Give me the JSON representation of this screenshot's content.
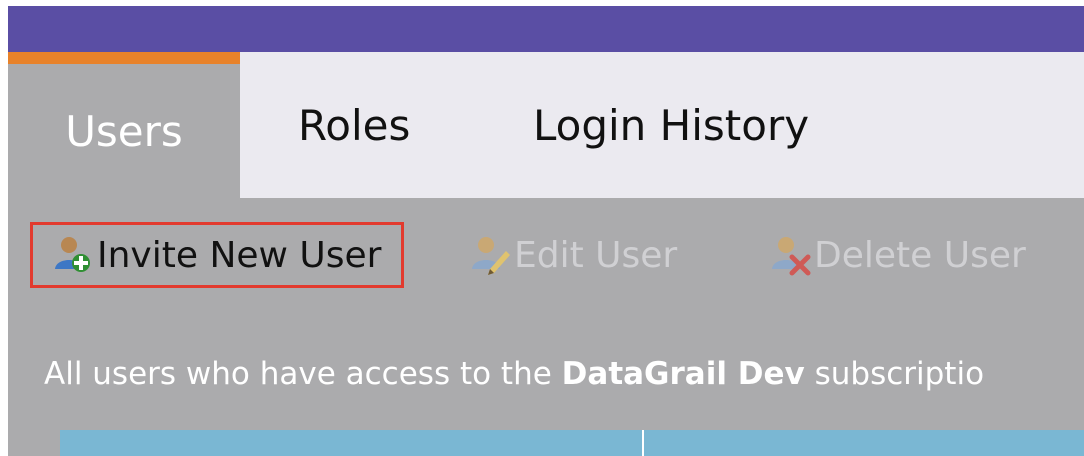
{
  "tabs": [
    {
      "label": "Users",
      "active": true
    },
    {
      "label": "Roles",
      "active": false
    },
    {
      "label": "Login History",
      "active": false
    }
  ],
  "toolbar": {
    "invite_label": "Invite New User",
    "edit_label": "Edit User",
    "delete_label": "Delete User"
  },
  "description": {
    "prefix": "All users who have access to the ",
    "subscription": "DataGrail Dev",
    "suffix": " subscriptio"
  },
  "colors": {
    "top_bar": "#5a4ea4",
    "active_tab_accent": "#e8822a",
    "highlight_border": "#e23a2e",
    "table_header": "#7ab7d3"
  }
}
